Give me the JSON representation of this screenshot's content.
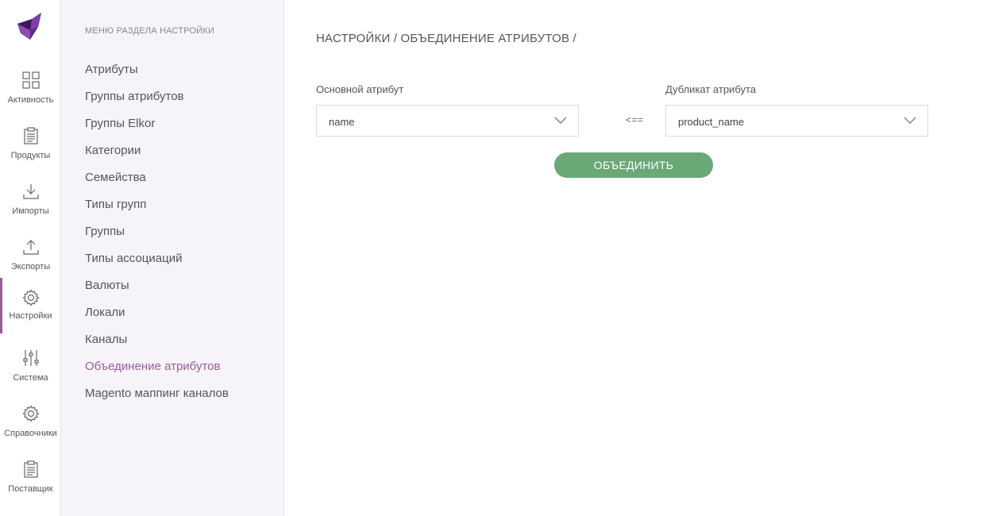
{
  "rail": {
    "items": [
      {
        "label": "Активность",
        "icon": "grid-icon"
      },
      {
        "label": "Продукты",
        "icon": "clipboard-icon"
      },
      {
        "label": "Импорты",
        "icon": "download-icon"
      },
      {
        "label": "Экспорты",
        "icon": "upload-icon"
      },
      {
        "label": "Настройки",
        "icon": "gear-icon",
        "active": true
      },
      {
        "label": "Система",
        "icon": "sliders-icon"
      },
      {
        "label": "Справочники",
        "icon": "gear-icon"
      },
      {
        "label": "Поставщик",
        "icon": "clipboard-icon"
      }
    ]
  },
  "submenu": {
    "title": "Меню раздела Настройки",
    "items": [
      "Атрибуты",
      "Группы атрибутов",
      "Группы Elkor",
      "Категории",
      "Семейства",
      "Типы групп",
      "Группы",
      "Типы ассоциаций",
      "Валюты",
      "Локали",
      "Каналы",
      "Объединение атрибутов",
      "Magento маппинг каналов"
    ],
    "active_index": 11
  },
  "main": {
    "breadcrumb": "Настройки / Объединение атрибутов /",
    "primary_label": "Основной атрибут",
    "primary_value": "name",
    "duplicate_label": "Дубликат атрибута",
    "duplicate_value": "product_name",
    "arrow": "<==",
    "merge_button": "Объединить"
  },
  "colors": {
    "accent": "#9a5a9c",
    "button": "#6aa877",
    "submenu_bg": "#f6f4f8"
  }
}
